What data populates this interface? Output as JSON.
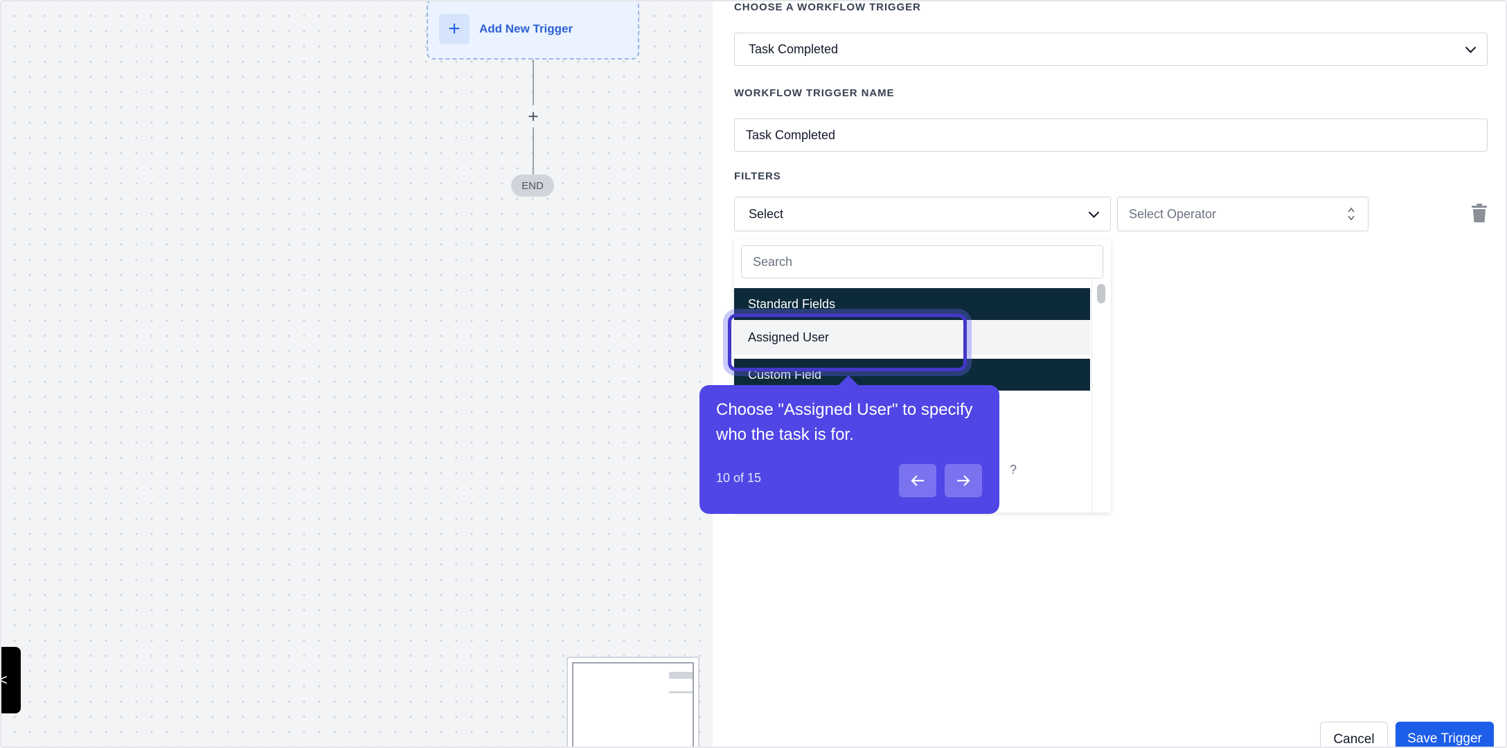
{
  "canvas": {
    "add_trigger_label": "Add New Trigger",
    "add_step_symbol": "+",
    "end_label": "END",
    "side_toggle_symbol": "<"
  },
  "panel": {
    "trigger_section_label": "CHOOSE A WORKFLOW TRIGGER",
    "trigger_selected": "Task Completed",
    "name_section_label": "WORKFLOW TRIGGER NAME",
    "name_value": "Task Completed",
    "filters_label": "FILTERS",
    "filter_field_value": "Select",
    "operator_placeholder": "Select Operator"
  },
  "dropdown": {
    "search_placeholder": "Search",
    "group_standard": "Standard Fields",
    "item_assigned_user": "Assigned User",
    "group_custom": "Custom Field",
    "partial_glyph": "?"
  },
  "tooltip": {
    "text": "Choose \"Assigned User\" to specify who the task is for.",
    "step": "10 of 15"
  },
  "footer": {
    "cancel_label": "Cancel",
    "save_label": "Save Trigger"
  },
  "colors": {
    "tooltip_bg": "#4f46e5",
    "save_button": "#1d5ee8",
    "group_header": "#0c2a3a",
    "canvas_bg": "#f3f4f6"
  }
}
